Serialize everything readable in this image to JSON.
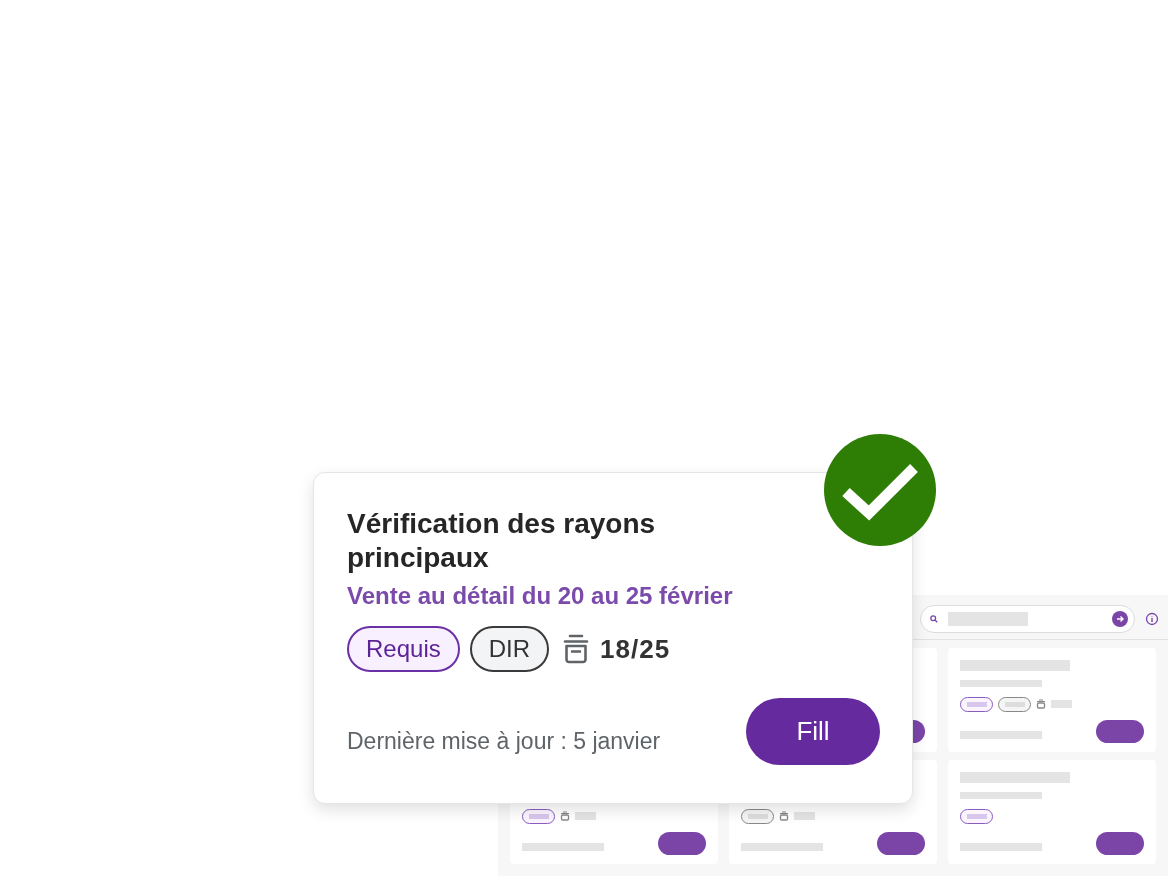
{
  "card": {
    "title": "Vérification des rayons principaux",
    "subtitle": "Vente au détail du 20 au 25 février",
    "completed": true,
    "tags": [
      {
        "label": "Requis",
        "kind": "required"
      },
      {
        "label": "DIR",
        "kind": "neutral"
      }
    ],
    "count": "18/25",
    "updated": "Dernière mise à jour : 5 janvier",
    "button": "Fill"
  }
}
